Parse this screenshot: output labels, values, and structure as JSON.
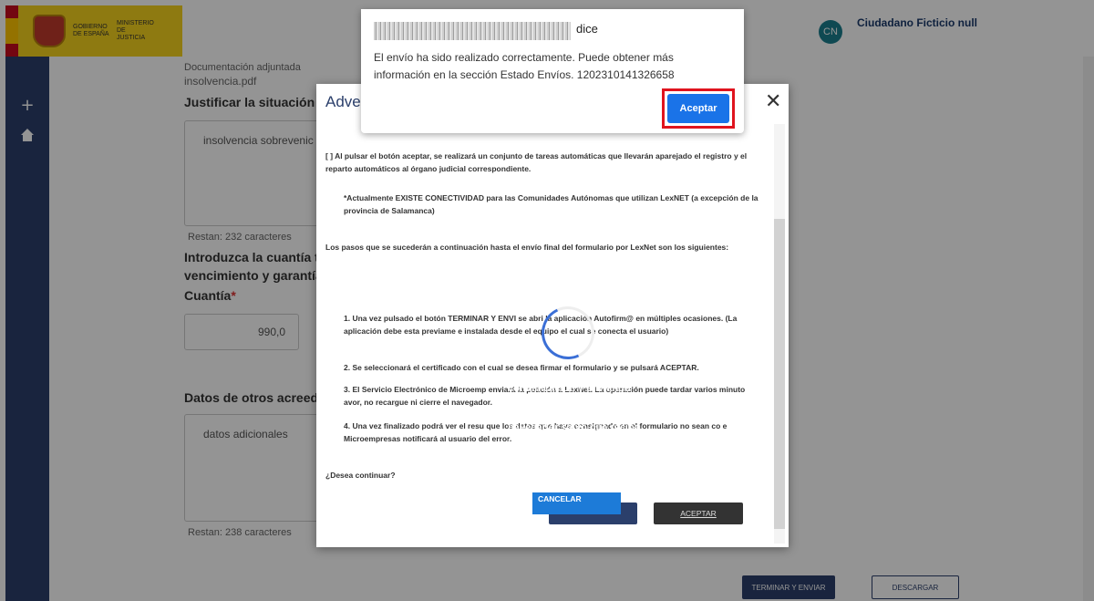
{
  "header": {
    "logo_line1": "GOBIERNO DE ESPAÑA",
    "logo_line2": "MINISTERIO DE JUSTICIA",
    "user_initials": "CN",
    "user_name": "Ciudadano Ficticio null"
  },
  "sidebar": {
    "icons": [
      "plus-icon",
      "home-icon"
    ]
  },
  "form": {
    "doc_label": "Documentación adjuntada",
    "doc_file": "insolvencia.pdf",
    "justify_label": "Justificar la situación de",
    "justify_value": "insolvencia sobrevenic",
    "justify_remaining": "Restan: 232 caracteres",
    "amount_label_1": "Introduzca la cuantía to",
    "amount_label_2": "vencimiento y garantía",
    "cuantia_label": "Cuantía",
    "cuantia_required": "*",
    "cuantia_value": "990,0",
    "creditors_label": "Datos de otros acreedor",
    "creditors_value": "datos adicionales",
    "creditors_remaining": "Restan: 238 caracteres"
  },
  "footer": {
    "submit_label": "TERMINAR Y ENVIAR",
    "download_label": "DESCARGAR"
  },
  "modal": {
    "title": "Adve",
    "close_glyph": "✕",
    "para1": "[ ] Al pulsar el botón aceptar, se realizará un conjunto de tareas automáticas que  llevarán aparejado el registro y el reparto automáticos al órgano judicial correspondiente.",
    "para2": "*Actualmente EXISTE CONECTIVIDAD para las Comunidades Autónomas que utilizan LexNET (a excepción de la provincia de Salamanca)",
    "para3": "Los pasos que se sucederán a continuación hasta el envío final del formulario por LexNet son los siguientes:",
    "step1": "1.   Una vez pulsado el botón TERMINAR Y ENVI    se abri   la aplicación Autofirm@ en múltiples ocasiones. (La aplicación debe esta  previame   e instalada desde el equipo el cual se conecta el usuario)",
    "step2": "2.   Se seleccionará el certificado con el cual se desea firmar el formulario y se pulsará ACEPTAR.",
    "step3": "3.   El Servicio Electrónico de Microemp                                         enviará la petición a LexNet. La operación puede tardar varios minuto                  avor, no recargue ni cierre el navegador.",
    "step4": "4.   Una vez finalizado podrá ver el resu                              que los datos que haya consignado en el formulario no sean co                                e Microempresas notificará al usuario del error.",
    "question": "¿Desea continuar?",
    "accept_label": "ACEPTAR"
  },
  "loading": {
    "message": "Estableciendo comunicación y enviando datos a LexNET. Por favor, no cierre la ventana ni el navegador salvo que reciba un error y acepte autofirma cuando se solicite.",
    "cancel_label": "CANCELAR"
  },
  "alert": {
    "suffix": "dice",
    "message": "El envío ha sido realizado correctamente. Puede obtener más información en la sección Estado Envíos. 1202310141326658",
    "ok_label": "Aceptar",
    "highlight_color": "#e0141e"
  }
}
